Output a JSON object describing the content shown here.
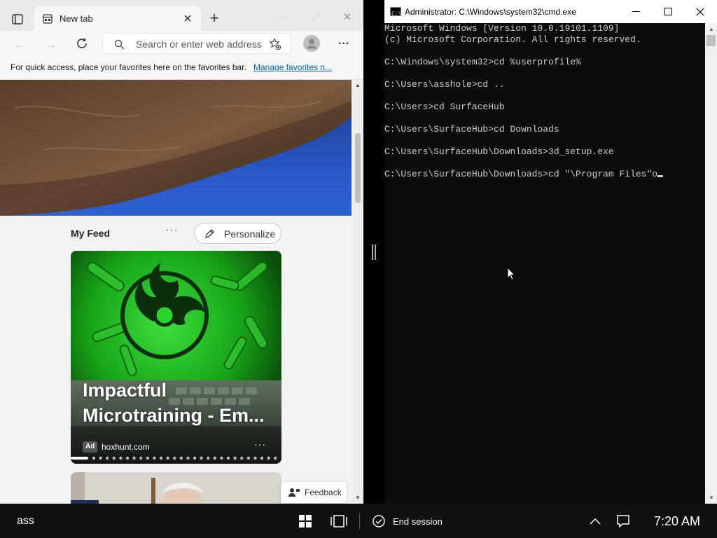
{
  "browser": {
    "tab_title": "New tab",
    "address_placeholder": "Search or enter web address",
    "favorites_bar_text": "For quick access, place your favorites here on the favorites bar.",
    "favorites_bar_link": "Manage favorites n...",
    "feed": {
      "title": "My Feed",
      "more": "···",
      "personalize_label": "Personalize",
      "card": {
        "title_line1": "Impactful",
        "title_line2": "Microtraining - Em...",
        "ad_label": "Ad",
        "source": "hoxhunt.com",
        "more": "···"
      },
      "feedback_label": "Feedback"
    }
  },
  "cmd": {
    "title": "Administrator: C:\\Windows\\system32\\cmd.exe",
    "lines": [
      "Microsoft Windows [Version 10.0.19101.1109]",
      "(c) Microsoft Corporation. All rights reserved.",
      "",
      "C:\\Windows\\system32>cd %userprofile%",
      "",
      "C:\\Users\\asshole>cd ..",
      "",
      "C:\\Users>cd SurfaceHub",
      "",
      "C:\\Users\\SurfaceHub>cd Downloads",
      "",
      "C:\\Users\\SurfaceHub\\Downloads>3d_setup.exe",
      "",
      "C:\\Users\\SurfaceHub\\Downloads>cd \"\\Program Files\"o"
    ]
  },
  "taskbar": {
    "user_label": "ass",
    "end_session_label": "End session",
    "time": "7:20 AM"
  },
  "colors": {
    "cmd_background": "#0c0c0c",
    "cmd_text": "#cccccc",
    "link": "#0066b4",
    "taskbar": "#101010"
  }
}
